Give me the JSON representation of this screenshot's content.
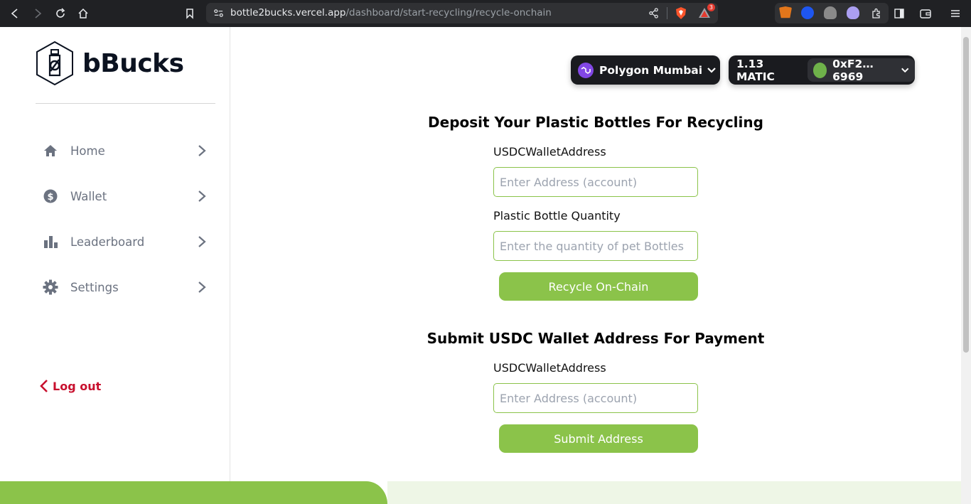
{
  "browser": {
    "url_host": "bottle2bucks.vercel.app",
    "url_path": "/dashboard/start-recycling/recycle-onchain",
    "extension_badge": "3"
  },
  "sidebar": {
    "brand": "bBucks",
    "items": [
      {
        "label": "Home",
        "icon": "home-icon"
      },
      {
        "label": "Wallet",
        "icon": "dollar-coin-icon"
      },
      {
        "label": "Leaderboard",
        "icon": "bar-chart-icon"
      },
      {
        "label": "Settings",
        "icon": "gear-icon"
      }
    ],
    "logout_label": "Log out"
  },
  "header": {
    "network": "Polygon Mumbai",
    "balance": "1.13 MATIC",
    "account": "0xF2…6969"
  },
  "deposit": {
    "title": "Deposit Your Plastic Bottles For Recycling",
    "address_label": "USDCWalletAddress",
    "address_placeholder": "Enter Address (account)",
    "quantity_label": "Plastic Bottle Quantity",
    "quantity_placeholder": "Enter the quantity of pet Bottles",
    "button": "Recycle On-Chain"
  },
  "payment": {
    "title": "Submit USDC Wallet Address For Payment",
    "address_label": "USDCWalletAddress",
    "address_placeholder": "Enter Address (account)",
    "button": "Submit Address"
  },
  "colors": {
    "accent": "#8bc34a",
    "logout": "#c8102e",
    "polygon": "#8247e5"
  }
}
